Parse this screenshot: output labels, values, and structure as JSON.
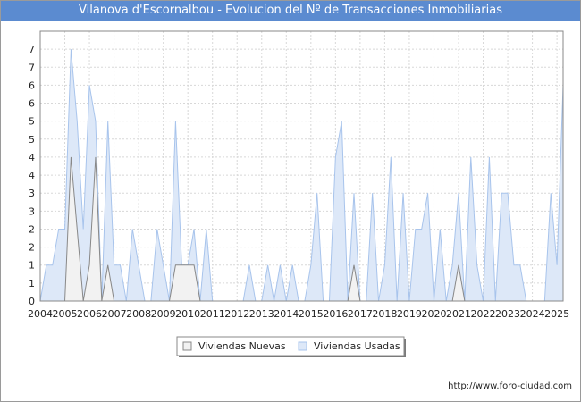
{
  "chart_data": {
    "type": "area",
    "title": "Vilanova d'Escornalbou - Evolucion del Nº de Transacciones Inmobiliarias",
    "xlabel": "",
    "ylabel": "",
    "y_tick_labels": [
      "0",
      "1",
      "1",
      "2",
      "2",
      "3",
      "3",
      "4",
      "4",
      "5",
      "5",
      "6",
      "6",
      "7",
      "7"
    ],
    "x_tick_labels": [
      "2004",
      "2005",
      "2006",
      "2007",
      "2008",
      "2009",
      "2010",
      "2011",
      "2012",
      "2013",
      "2014",
      "2015",
      "2016",
      "2017",
      "2018",
      "2019",
      "2020",
      "2021",
      "2022",
      "2023",
      "2024",
      "2025"
    ],
    "ylim": [
      0,
      7.5
    ],
    "xlim": [
      2004,
      2025.25
    ],
    "grid": true,
    "legend_position": "bottom-center",
    "colors": {
      "usadas_fill": "#dde8f8",
      "usadas_line": "#a8c4ec",
      "nuevas_fill": "#f2f2f2",
      "nuevas_line": "#888888",
      "title_bg": "#5b8bd0"
    },
    "quarters": [
      "2004Q1",
      "2004Q2",
      "2004Q3",
      "2004Q4",
      "2005Q1",
      "2005Q2",
      "2005Q3",
      "2005Q4",
      "2006Q1",
      "2006Q2",
      "2006Q3",
      "2006Q4",
      "2007Q1",
      "2007Q2",
      "2007Q3",
      "2007Q4",
      "2008Q1",
      "2008Q2",
      "2008Q3",
      "2008Q4",
      "2009Q1",
      "2009Q2",
      "2009Q3",
      "2009Q4",
      "2010Q1",
      "2010Q2",
      "2010Q3",
      "2010Q4",
      "2011Q1",
      "2011Q2",
      "2011Q3",
      "2011Q4",
      "2012Q1",
      "2012Q2",
      "2012Q3",
      "2012Q4",
      "2013Q1",
      "2013Q2",
      "2013Q3",
      "2013Q4",
      "2014Q1",
      "2014Q2",
      "2014Q3",
      "2014Q4",
      "2015Q1",
      "2015Q2",
      "2015Q3",
      "2015Q4",
      "2016Q1",
      "2016Q2",
      "2016Q3",
      "2016Q4",
      "2017Q1",
      "2017Q2",
      "2017Q3",
      "2017Q4",
      "2018Q1",
      "2018Q2",
      "2018Q3",
      "2018Q4",
      "2019Q1",
      "2019Q2",
      "2019Q3",
      "2019Q4",
      "2020Q1",
      "2020Q2",
      "2020Q3",
      "2020Q4",
      "2021Q1",
      "2021Q2",
      "2021Q3",
      "2021Q4",
      "2022Q1",
      "2022Q2",
      "2022Q3",
      "2022Q4",
      "2023Q1",
      "2023Q2",
      "2023Q3",
      "2023Q4",
      "2024Q1",
      "2024Q2",
      "2024Q3",
      "2024Q4",
      "2025Q1",
      "2025Q2"
    ],
    "series": [
      {
        "name": "Viviendas Usadas",
        "values": [
          0,
          1,
          1,
          2,
          2,
          7,
          5,
          2,
          6,
          5,
          0,
          5,
          1,
          1,
          0,
          2,
          1,
          0,
          0,
          2,
          1,
          0,
          5,
          1,
          1,
          2,
          0,
          2,
          0,
          0,
          0,
          0,
          0,
          0,
          1,
          0,
          0,
          1,
          0,
          1,
          0,
          1,
          0,
          0,
          1,
          3,
          0,
          0,
          4,
          5,
          0,
          3,
          0,
          0,
          3,
          0,
          1,
          4,
          0,
          3,
          0,
          2,
          2,
          3,
          0,
          2,
          0,
          1,
          3,
          0,
          4,
          1,
          0,
          4,
          0,
          3,
          3,
          1,
          1,
          0,
          0,
          0,
          0,
          3,
          1,
          6
        ]
      },
      {
        "name": "Viviendas Nuevas",
        "values": [
          0,
          0,
          0,
          0,
          0,
          4,
          2,
          0,
          1,
          4,
          0,
          1,
          0,
          0,
          0,
          0,
          0,
          0,
          0,
          0,
          0,
          0,
          1,
          1,
          1,
          1,
          0,
          0,
          0,
          0,
          0,
          0,
          0,
          0,
          0,
          0,
          0,
          0,
          0,
          0,
          0,
          0,
          0,
          0,
          0,
          0,
          0,
          0,
          0,
          0,
          0,
          1,
          0,
          0,
          0,
          0,
          0,
          0,
          0,
          0,
          0,
          0,
          0,
          0,
          0,
          0,
          0,
          0,
          1,
          0,
          0,
          0,
          0,
          0,
          0,
          0,
          0,
          0,
          0,
          0,
          0,
          0,
          0,
          0,
          0,
          0
        ]
      }
    ]
  },
  "source_text": "http://www.foro-ciudad.com"
}
